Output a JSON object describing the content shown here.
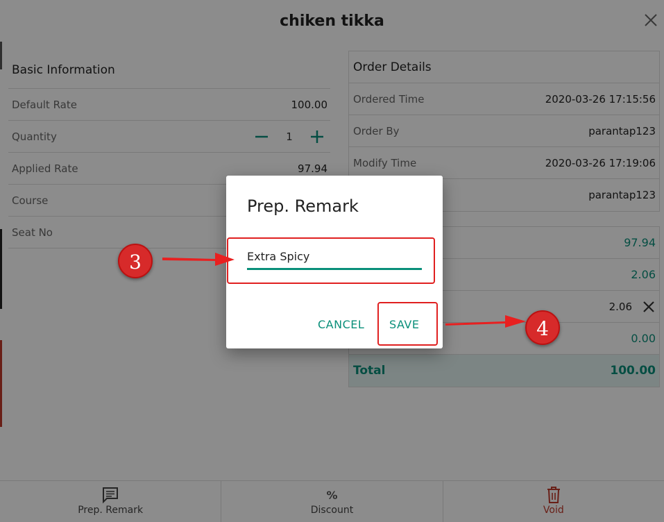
{
  "item_modal": {
    "title": "chiken tikka",
    "basic_info": {
      "heading": "Basic Information",
      "rows": [
        {
          "label": "Default Rate",
          "value": "100.00"
        },
        {
          "label": "Quantity",
          "value": "1"
        },
        {
          "label": "Applied Rate",
          "value": "97.94"
        },
        {
          "label": "Course",
          "value": ""
        },
        {
          "label": "Seat No",
          "value": ""
        }
      ]
    },
    "order_details": {
      "heading": "Order Details",
      "rows": [
        {
          "label": "Ordered Time",
          "value": "2020-03-26 17:15:56"
        },
        {
          "label": "Order By",
          "value": "parantap123"
        },
        {
          "label": "Modify Time",
          "value": "2020-03-26 17:19:06"
        },
        {
          "label": "",
          "value": "parantap123"
        }
      ]
    },
    "amounts": {
      "rows": [
        {
          "label": "",
          "value": "97.94"
        },
        {
          "label": "",
          "value": "2.06"
        },
        {
          "label": "",
          "value": "2.06"
        },
        {
          "label": "",
          "value": "0.00"
        }
      ],
      "total_label": "Total",
      "total_value": "100.00"
    }
  },
  "bottom_bar": {
    "prep_remark": "Prep. Remark",
    "discount": "Discount",
    "discount_symbol": "%",
    "void": "Void"
  },
  "dialog": {
    "title": "Prep. Remark",
    "input_value": "Extra Spicy",
    "cancel_label": "CANCEL",
    "save_label": "SAVE"
  },
  "annotations": {
    "step_3": "3",
    "step_4": "4"
  },
  "colors": {
    "accent": "#0a8f7a",
    "annotation_red": "#e02020",
    "void_red": "#c0392b"
  },
  "icons": [
    "close-icon",
    "minus-icon",
    "plus-icon",
    "remove-x-icon",
    "comment-icon",
    "percent-icon",
    "trash-icon"
  ]
}
